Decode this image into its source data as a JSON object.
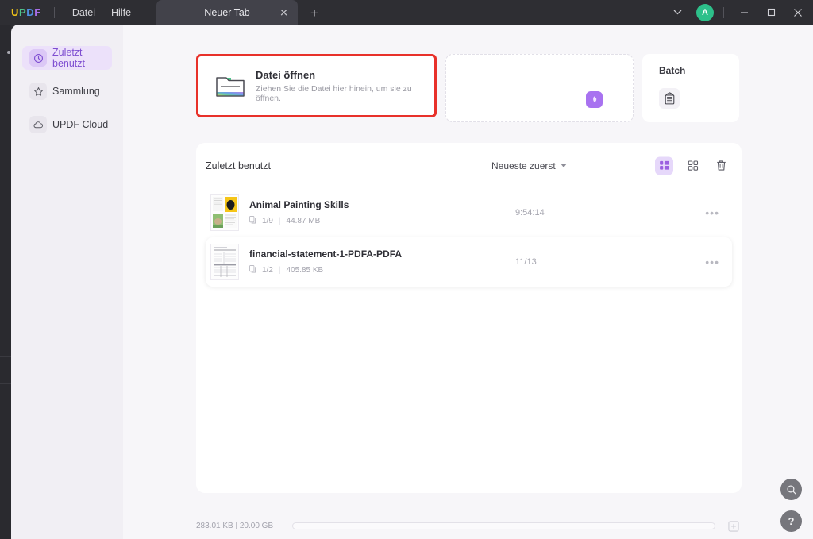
{
  "titlebar": {
    "logo": {
      "l1": "U",
      "l2": "P",
      "l3": "D",
      "l4": "F"
    },
    "menus": [
      {
        "label": "Datei",
        "name": "menu-datei"
      },
      {
        "label": "Hilfe",
        "name": "menu-hilfe"
      }
    ],
    "tab": {
      "label": "Neuer Tab",
      "close": "✕"
    },
    "add_tab": "+",
    "chevron": "⌄",
    "avatar": "A",
    "minimize": "—",
    "maximize": "□",
    "close": "✕"
  },
  "sidebar": {
    "items": [
      {
        "label": "Zuletzt benutzt",
        "icon": "clock-icon",
        "active": true
      },
      {
        "label": "Sammlung",
        "icon": "star-icon",
        "active": false
      },
      {
        "label": "UPDF Cloud",
        "icon": "cloud-icon",
        "active": false
      }
    ]
  },
  "cards": {
    "open": {
      "title": "Datei öffnen",
      "subtitle": "Ziehen Sie die Datei hier hinein, um sie zu öffnen.",
      "highlight_color": "#e8312a"
    },
    "middle": {
      "badge_color": "#a872f0"
    },
    "batch": {
      "title": "Batch"
    }
  },
  "recent": {
    "title": "Zuletzt benutzt",
    "sort_label": "Neueste zuerst",
    "tools": [
      {
        "name": "list-view-icon",
        "active": true
      },
      {
        "name": "grid-view-icon",
        "active": false
      },
      {
        "name": "trash-icon",
        "active": false
      }
    ],
    "files": [
      {
        "name": "Animal Painting Skills",
        "pages": "1/9",
        "size": "44.87 MB",
        "time": "9:54:14",
        "more": "•••"
      },
      {
        "name": "financial-statement-1-PDFA-PDFA",
        "pages": "1/2",
        "size": "405.85 KB",
        "time": "11/13",
        "more": "•••"
      }
    ]
  },
  "statusbar": {
    "storage": "283.01 KB | 20.00 GB"
  },
  "fab": {
    "search": "search-icon",
    "help": "?"
  }
}
